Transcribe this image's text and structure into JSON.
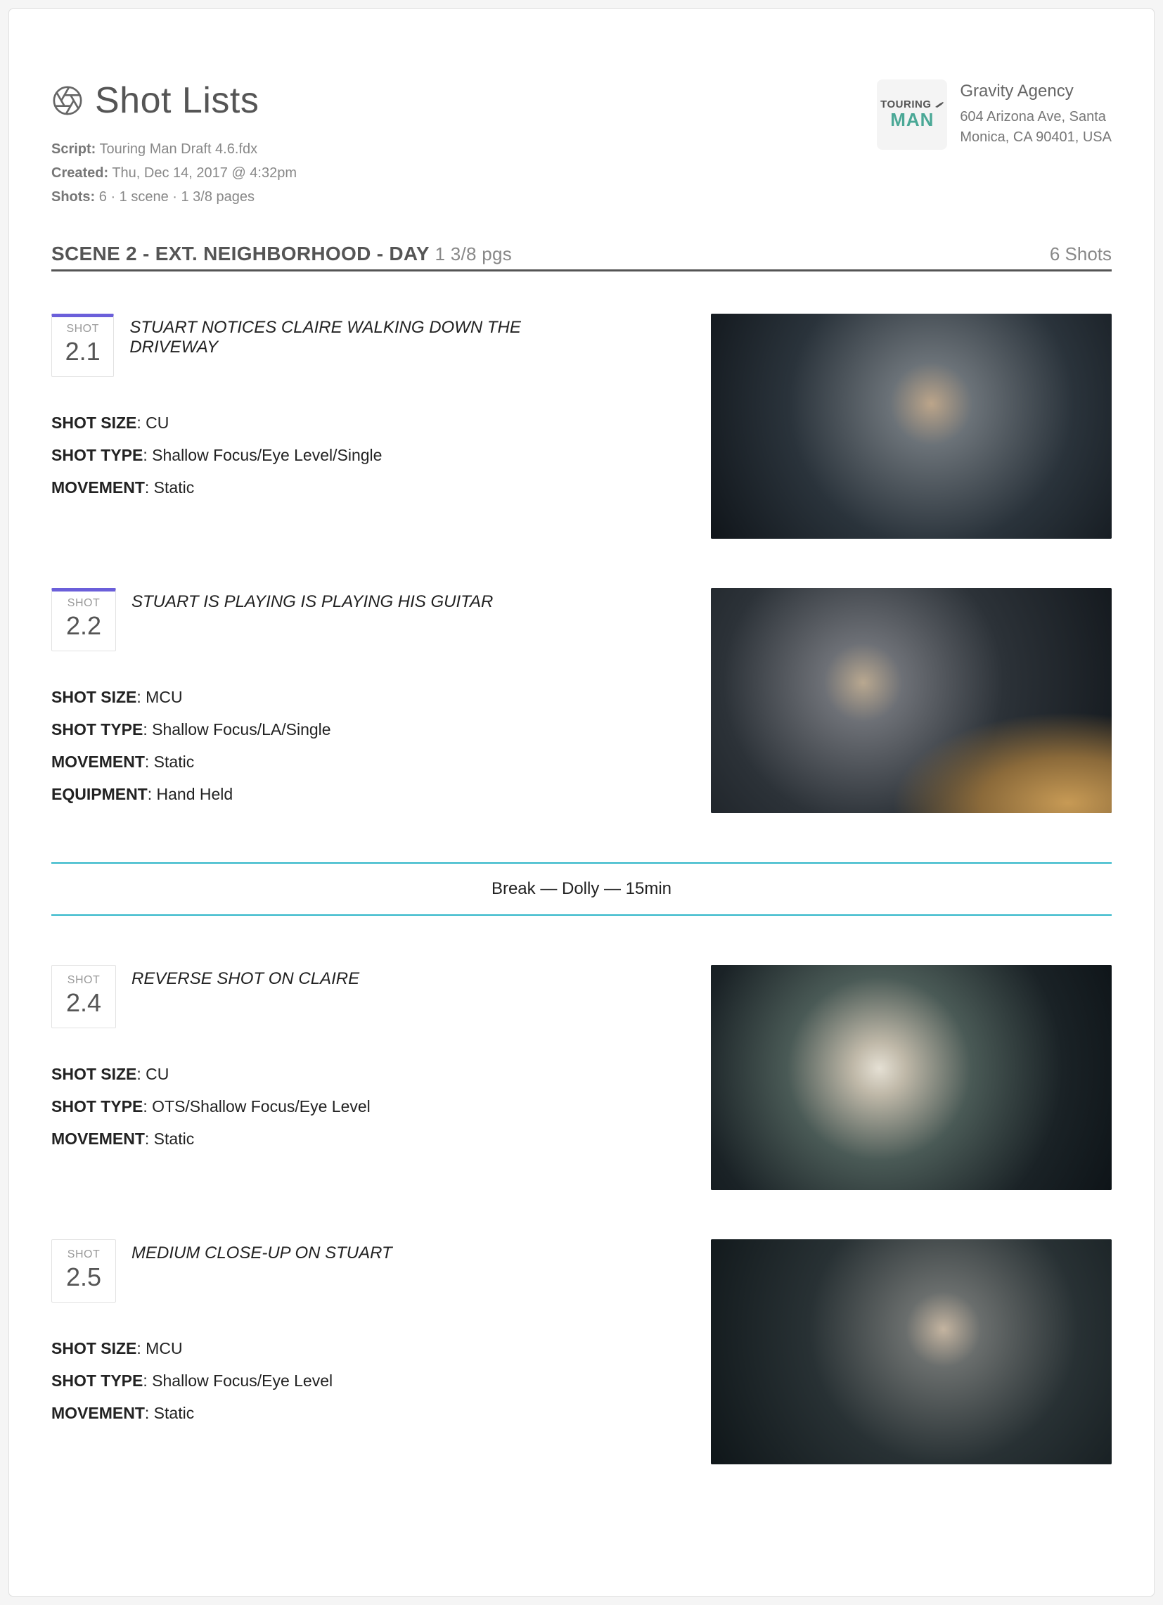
{
  "page_title": "Shot Lists",
  "meta": {
    "script_label": "Script:",
    "script_value": "Touring Man Draft 4.6.fdx",
    "created_label": "Created:",
    "created_value": "Thu, Dec 14, 2017 @ 4:32pm",
    "shots_label": "Shots:",
    "shots_value": "6   ·   1 scene   ·   1 3/8 pages"
  },
  "agency": {
    "name": "Gravity Agency",
    "address_line1": "604 Arizona Ave, Santa",
    "address_line2": "Monica, CA 90401, USA",
    "logo_line1": "TOURING",
    "logo_line2": "MAN"
  },
  "scene": {
    "heading": "SCENE 2 - EXT. NEIGHBORHOOD - DAY",
    "pgs": "1 3/8 pgs",
    "shot_count": "6 Shots"
  },
  "shot_badge_label": "SHOT",
  "labels": {
    "shot_size": "SHOT SIZE",
    "shot_type": "SHOT TYPE",
    "movement": "MOVEMENT",
    "equipment": "EQUIPMENT"
  },
  "break_text": "Break — Dolly — 15min",
  "shots": [
    {
      "number": "2.1",
      "accent": true,
      "description": "STUART NOTICES CLAIRE WALKING DOWN THE DRIVEWAY",
      "size": "CU",
      "type": "Shallow Focus/Eye Level/Single",
      "movement": "Static",
      "equipment": "",
      "img_class": "ph1"
    },
    {
      "number": "2.2",
      "accent": true,
      "description": "STUART IS PLAYING IS PLAYING HIS GUITAR",
      "size": "MCU",
      "type": "Shallow Focus/LA/Single",
      "movement": "Static",
      "equipment": "Hand Held",
      "img_class": "ph2"
    },
    {
      "number": "2.4",
      "accent": false,
      "description": "REVERSE SHOT ON CLAIRE",
      "size": "CU",
      "type": "OTS/Shallow Focus/Eye Level",
      "movement": "Static",
      "equipment": "",
      "img_class": "ph3"
    },
    {
      "number": "2.5",
      "accent": false,
      "description": "MEDIUM CLOSE-UP ON STUART",
      "size": "MCU",
      "type": "Shallow Focus/Eye Level",
      "movement": "Static",
      "equipment": "",
      "img_class": "ph4"
    }
  ]
}
